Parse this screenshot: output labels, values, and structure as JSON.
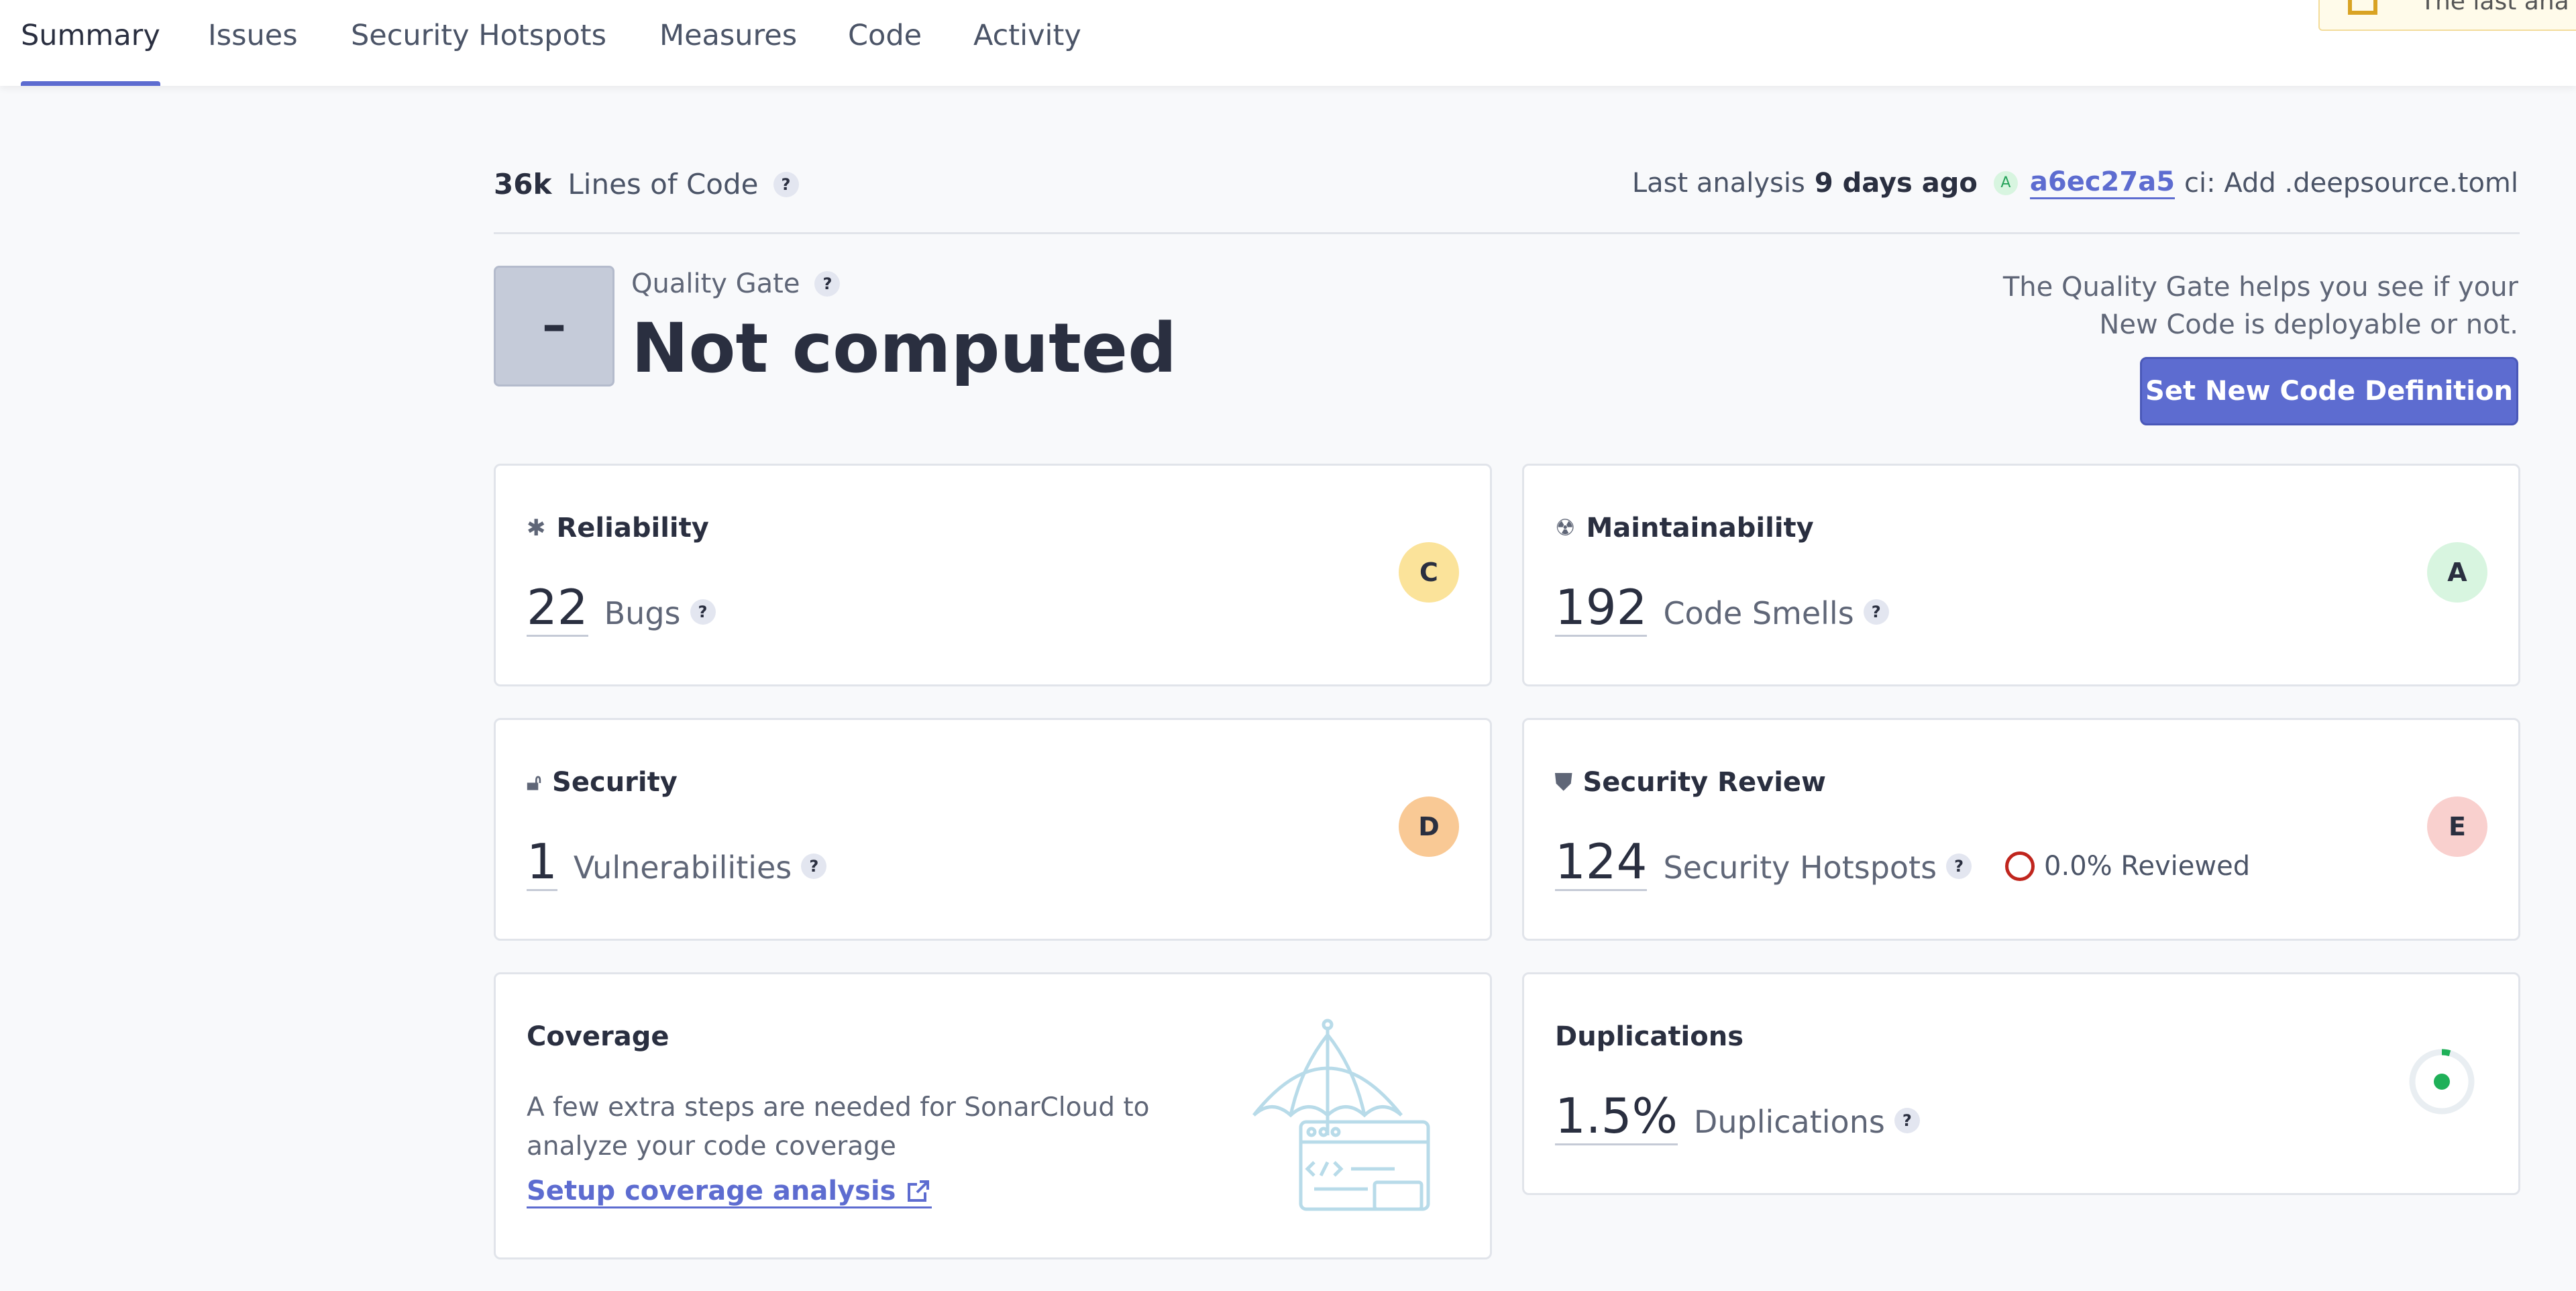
{
  "tabs": [
    {
      "label": "Summary",
      "active": true
    },
    {
      "label": "Issues"
    },
    {
      "label": "Security Hotspots"
    },
    {
      "label": "Measures"
    },
    {
      "label": "Code"
    },
    {
      "label": "Activity"
    }
  ],
  "notice": {
    "text": "The last ana"
  },
  "summary": {
    "lines_value": "36k",
    "lines_label": "Lines of Code",
    "help": "?",
    "last_analysis_label": "Last analysis",
    "last_analysis_age": "9 days ago",
    "commit_badge": "A",
    "commit_hash": "a6ec27a5",
    "commit_message": "ci: Add .deepsource.toml"
  },
  "quality_gate": {
    "status_symbol": "–",
    "label": "Quality Gate",
    "status": "Not computed",
    "help_line1": "The Quality Gate helps you see if your",
    "help_line2": "New Code is deployable or not.",
    "button_label": "Set New Code Definition"
  },
  "reliability": {
    "title": "Reliability",
    "value": "22",
    "label": "Bugs",
    "rating": "C"
  },
  "maintainability": {
    "title": "Maintainability",
    "value": "192",
    "label": "Code Smells",
    "rating": "A"
  },
  "security": {
    "title": "Security",
    "value": "1",
    "label": "Vulnerabilities",
    "rating": "D"
  },
  "security_review": {
    "title": "Security Review",
    "value": "124",
    "label": "Security Hotspots",
    "reviewed": "0.0% Reviewed",
    "rating": "E"
  },
  "coverage": {
    "title": "Coverage",
    "desc_line1": "A few extra steps are needed for SonarCloud to",
    "desc_line2": "analyze your code coverage",
    "link": "Setup coverage analysis"
  },
  "duplications": {
    "title": "Duplications",
    "value": "1.5%",
    "label": "Duplications"
  },
  "colors": {
    "accent": "#5d6cd0",
    "rating_A": "#d8f5e0",
    "rating_C": "#fbe39a",
    "rating_D": "#f9c995",
    "rating_E": "#f9d0ce"
  }
}
